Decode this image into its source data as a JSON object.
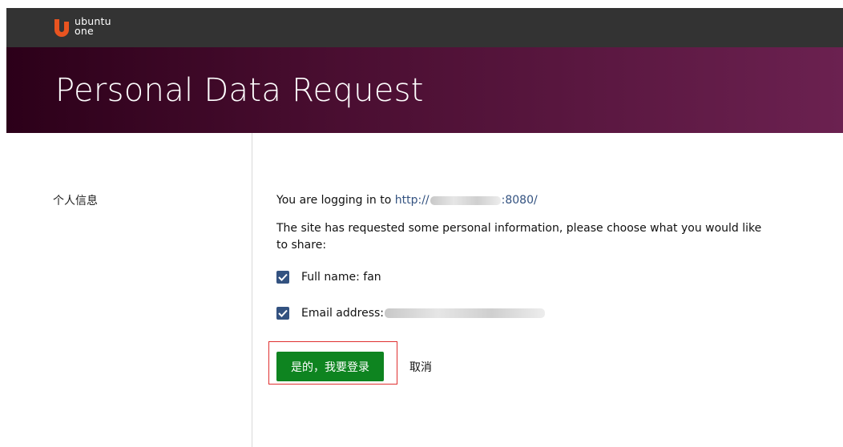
{
  "header": {
    "logo_line1": "ubuntu",
    "logo_line2": "one",
    "logo_icon": "ubuntu-one-logo-icon",
    "brand_color": "#e95420"
  },
  "hero": {
    "title": "Personal Data Request"
  },
  "sidebar": {
    "label": "个人信息"
  },
  "main": {
    "login_prefix": "You are logging in to",
    "site_url_start": "http://",
    "site_url_end": ":8080/",
    "request_message": "The site has requested some personal information, please choose what you would like to share:",
    "fields": [
      {
        "label": "Full name: fan",
        "checked": true
      },
      {
        "label": "Email address:",
        "checked": true
      }
    ],
    "confirm_label": "是的，我要登录",
    "cancel_label": "取消"
  },
  "colors": {
    "topbar": "#333333",
    "hero_dark": "#2c0019",
    "hero_light": "#6b2150",
    "checkbox": "#335280",
    "confirm_button": "#0e8420",
    "highlight_border": "#e03030",
    "link": "#335280"
  }
}
